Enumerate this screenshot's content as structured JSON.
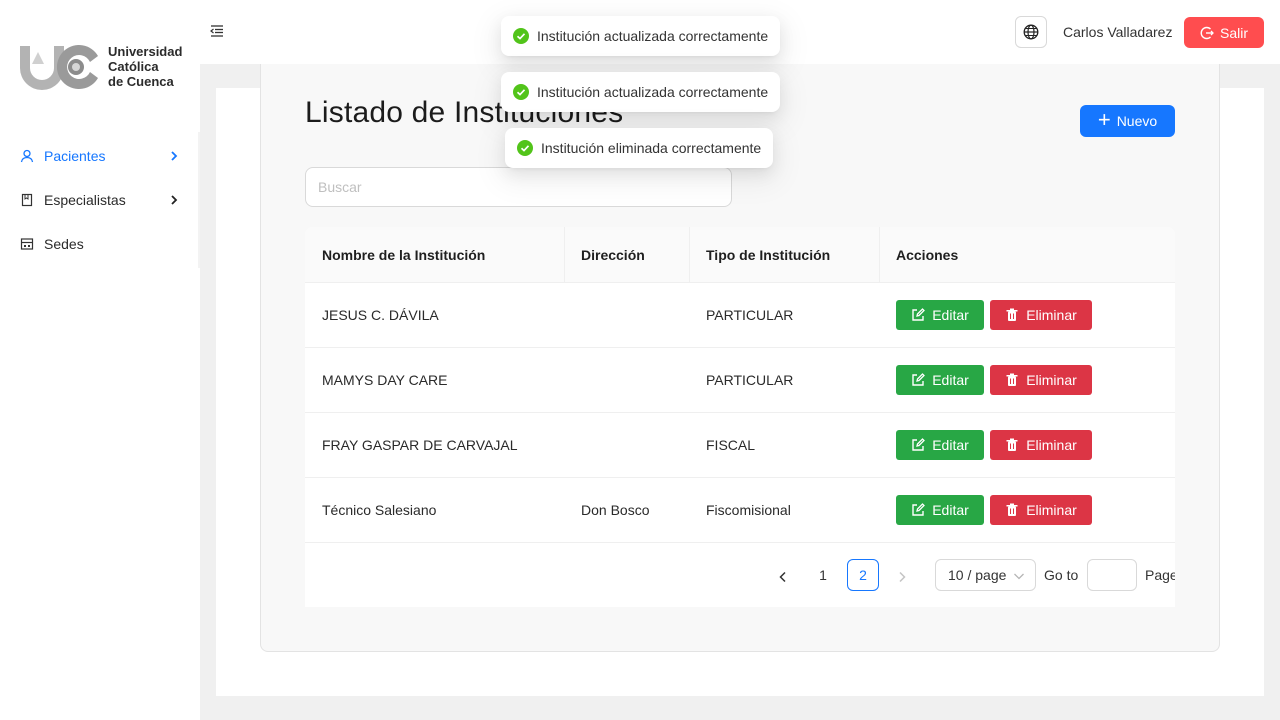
{
  "brand": {
    "name_line1": "Universidad",
    "name_line2": "Católica",
    "name_line3": "de Cuenca"
  },
  "sidebar": {
    "items": [
      {
        "label": "Pacientes",
        "icon": "user-icon",
        "active": true,
        "expandable": true
      },
      {
        "label": "Especialistas",
        "icon": "book-icon",
        "active": false,
        "expandable": true
      },
      {
        "label": "Sedes",
        "icon": "building-icon",
        "active": false,
        "expandable": false
      }
    ]
  },
  "header": {
    "user_name": "Carlos Valladarez",
    "logout_label": "Salir"
  },
  "toasts": [
    {
      "message": "Institución actualizada correctamente",
      "type": "success"
    },
    {
      "message": "Institución actualizada correctamente",
      "type": "success"
    },
    {
      "message": "Institución eliminada correctamente",
      "type": "success"
    }
  ],
  "main": {
    "title": "Listado de Instituciones",
    "new_button": "Nuevo",
    "search_placeholder": "Buscar"
  },
  "table": {
    "columns": [
      "Nombre de la Institución",
      "Dirección",
      "Tipo de Institución",
      "Acciones"
    ],
    "rows": [
      {
        "nombre": "JESUS C. DÁVILA",
        "direccion": "",
        "tipo": "PARTICULAR"
      },
      {
        "nombre": "MAMYS DAY CARE",
        "direccion": "",
        "tipo": "PARTICULAR"
      },
      {
        "nombre": "FRAY GASPAR DE CARVAJAL",
        "direccion": "",
        "tipo": "FISCAL"
      },
      {
        "nombre": "Técnico Salesiano",
        "direccion": "Don Bosco",
        "tipo": "Fiscomisional"
      }
    ],
    "edit_label": "Editar",
    "delete_label": "Eliminar"
  },
  "pagination": {
    "pages": [
      "1",
      "2"
    ],
    "current_page": "2",
    "page_size": "10 / page",
    "goto_label": "Go to",
    "page_label": "Page"
  },
  "colors": {
    "primary": "#1677ff",
    "danger_header": "#ff4d4f",
    "edit": "#28a745",
    "delete": "#dc3545",
    "success": "#52c41a"
  }
}
